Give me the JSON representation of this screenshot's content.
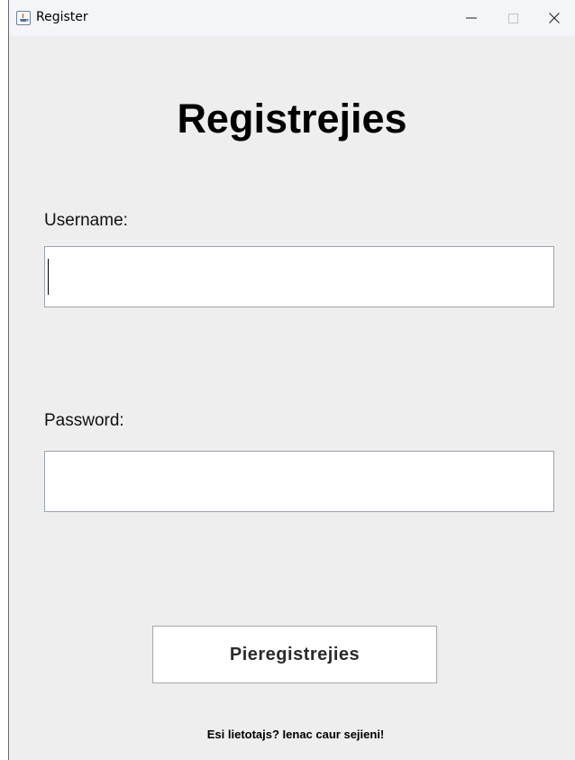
{
  "window": {
    "title": "Register",
    "controls": {
      "minimize_icon": "minimize-icon",
      "maximize_icon": "maximize-icon",
      "close_icon": "close-icon"
    },
    "app_icon": "java-icon"
  },
  "form": {
    "heading": "Registrejies",
    "username": {
      "label": "Username:",
      "value": "",
      "placeholder": ""
    },
    "password": {
      "label": "Password:",
      "value": "",
      "placeholder": ""
    },
    "submit_label": "Pieregistrejies",
    "login_link": "Esi lietotajs? Ienac caur sejieni!"
  },
  "colors": {
    "background": "#eeeeee",
    "titlebar": "#f3f5f8",
    "field_border": "#9aa3ad",
    "text": "#000000"
  }
}
